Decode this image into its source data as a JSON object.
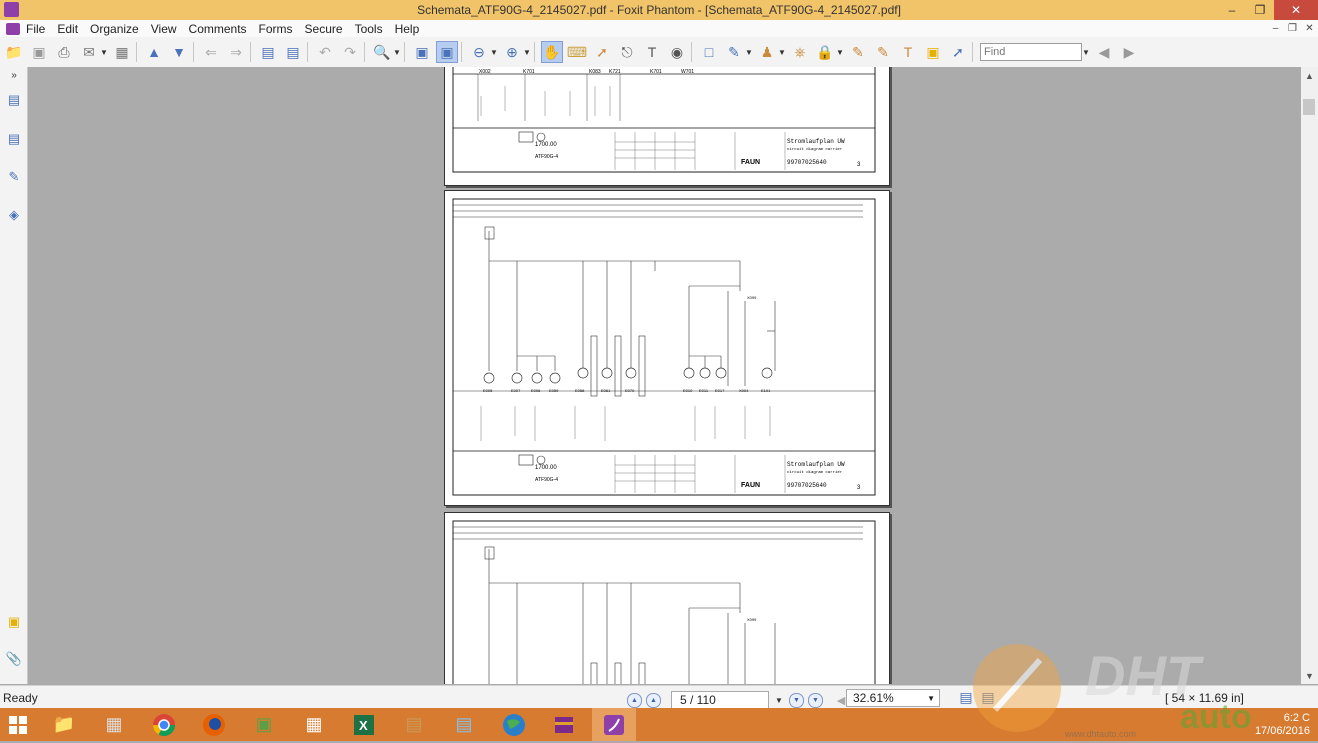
{
  "window": {
    "title": "Schemata_ATF90G-4_2145027.pdf - Foxit Phantom - [Schemata_ATF90G-4_2145027.pdf]",
    "controls": [
      "–",
      "❐",
      "✕"
    ]
  },
  "menu": [
    "File",
    "Edit",
    "Organize",
    "View",
    "Comments",
    "Forms",
    "Secure",
    "Tools",
    "Help"
  ],
  "mdi_controls": [
    "–",
    "❐",
    "✕"
  ],
  "toolbar": {
    "find_placeholder": "Find"
  },
  "pages": {
    "title_block": {
      "stromlaufplan": "Stromlaufplan UW",
      "subtitle": "circuit diagram carrier",
      "drawing_no": "99707025640",
      "faun": "FAUN",
      "qty": "1700.00",
      "project": "ATF90G-4",
      "sheet_top": "3",
      "sheet_mid": "3"
    },
    "labels_top": [
      "X002",
      "K701",
      "K083",
      "K721",
      "K701",
      "W701"
    ],
    "labels_mid": [
      "E005",
      "E007",
      "E006",
      "E059",
      "E058",
      "E061",
      "E070",
      "E010",
      "E011",
      "E017",
      "X004",
      "E101"
    ],
    "connector_mid": "X099",
    "connector_low": "X099"
  },
  "status": {
    "ready": "Ready",
    "page_display": "5 / 110",
    "zoom": "32.61%",
    "dimensions": "[  54 × 11.69 in]"
  },
  "taskbar": {
    "time": "6:2 C",
    "date": "17/06/2016"
  },
  "watermark": {
    "text": "DHT",
    "text2": "auto",
    "brand_url": "www.dhtauto.com"
  }
}
